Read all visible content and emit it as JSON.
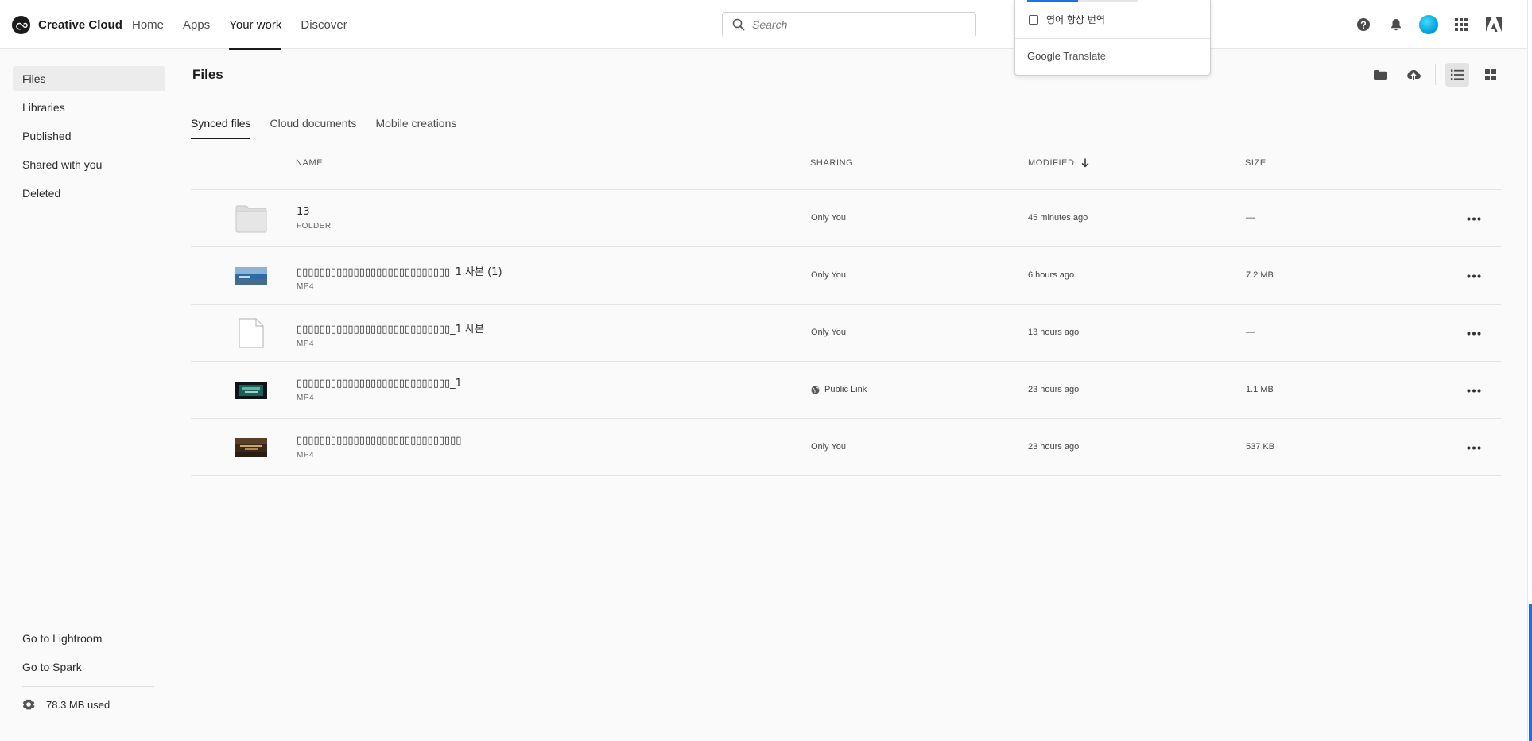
{
  "brand": {
    "name": "Creative Cloud"
  },
  "nav": {
    "items": [
      {
        "label": "Home",
        "active": false
      },
      {
        "label": "Apps",
        "active": false
      },
      {
        "label": "Your work",
        "active": true
      },
      {
        "label": "Discover",
        "active": false
      }
    ]
  },
  "search": {
    "placeholder": "Search",
    "value": ""
  },
  "translate_popup": {
    "option_label": "영어 항상 번역",
    "brand_google": "Google",
    "brand_translate": "Translate"
  },
  "top_icons": [
    "help-icon",
    "bell-icon",
    "avatar",
    "apps-grid-icon",
    "adobe-logo-icon"
  ],
  "sidebar": {
    "items": [
      {
        "label": "Files",
        "active": true
      },
      {
        "label": "Libraries",
        "active": false
      },
      {
        "label": "Published",
        "active": false
      },
      {
        "label": "Shared with you",
        "active": false
      },
      {
        "label": "Deleted",
        "active": false
      }
    ],
    "footer_links": [
      {
        "label": "Go to Lightroom"
      },
      {
        "label": "Go to Spark"
      }
    ],
    "storage": "78.3 MB used"
  },
  "main": {
    "title": "Files",
    "tabs": [
      {
        "label": "Synced files",
        "active": true
      },
      {
        "label": "Cloud documents",
        "active": false
      },
      {
        "label": "Mobile creations",
        "active": false
      }
    ],
    "columns": {
      "name": "NAME",
      "sharing": "SHARING",
      "modified": "MODIFIED",
      "size": "SIZE"
    },
    "rows": [
      {
        "name": "13",
        "type": "FOLDER",
        "sharing": "Only You",
        "modified": "45 minutes ago",
        "size": "—",
        "thumb": "folder"
      },
      {
        "name": "▯▯▯▯▯▯▯▯▯▯▯▯▯▯▯▯▯▯▯▯▯▯▯▯▯▯▯_1 사본 (1)",
        "type": "MP4",
        "sharing": "Only You",
        "modified": "6 hours ago",
        "size": "7.2 MB",
        "thumb": "video-blue"
      },
      {
        "name": "▯▯▯▯▯▯▯▯▯▯▯▯▯▯▯▯▯▯▯▯▯▯▯▯▯▯▯_1 사본",
        "type": "MP4",
        "sharing": "Only You",
        "modified": "13 hours ago",
        "size": "—",
        "thumb": "doc"
      },
      {
        "name": "▯▯▯▯▯▯▯▯▯▯▯▯▯▯▯▯▯▯▯▯▯▯▯▯▯▯▯_1",
        "type": "MP4",
        "sharing": "Public Link",
        "modified": "23 hours ago",
        "size": "1.1 MB",
        "thumb": "video-dark"
      },
      {
        "name": "▯▯▯▯▯▯▯▯▯▯▯▯▯▯▯▯▯▯▯▯▯▯▯▯▯▯▯▯▯",
        "type": "MP4",
        "sharing": "Only You",
        "modified": "23 hours ago",
        "size": "537 KB",
        "thumb": "video-brown"
      }
    ]
  },
  "colors": {
    "accent": "#1473e6",
    "text": "#2c2c2c",
    "avatar": "#00b3e8"
  }
}
